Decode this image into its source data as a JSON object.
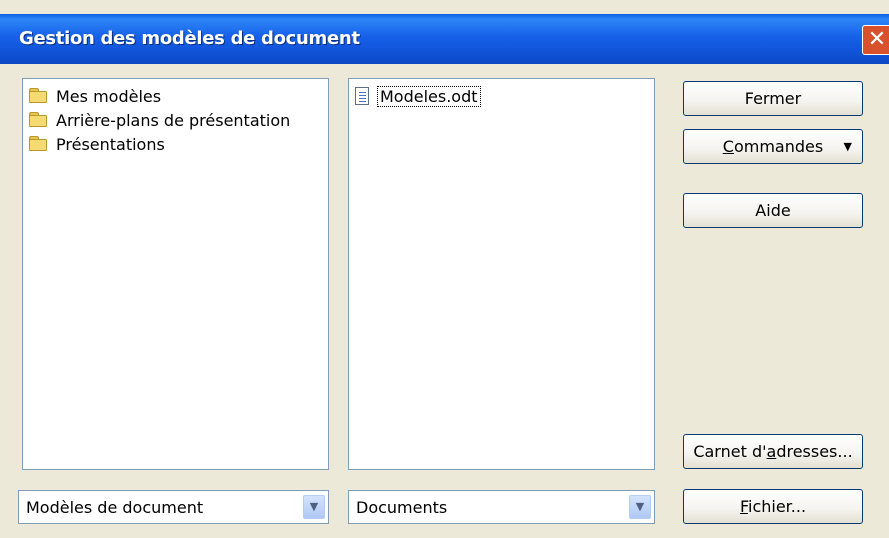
{
  "window": {
    "title": "Gestion des modèles de document",
    "close_glyph": "✕",
    "colors": {
      "titlebar": "#0f52d6",
      "background": "#ece9d8",
      "close": "#d9512c"
    }
  },
  "categories": {
    "items": [
      {
        "label": "Mes modèles",
        "icon": "folder-icon"
      },
      {
        "label": "Arrière-plans de présentation",
        "icon": "folder-icon"
      },
      {
        "label": "Présentations",
        "icon": "folder-icon"
      }
    ],
    "combo_value": "Modèles de document"
  },
  "documents": {
    "items": [
      {
        "label": "Modeles.odt",
        "icon": "document-icon"
      }
    ],
    "combo_value": "Documents"
  },
  "buttons": {
    "close": {
      "label": "Fermer"
    },
    "commands": {
      "mnemonic": "C",
      "rest": "ommandes",
      "arrow": "▼"
    },
    "help": {
      "label": "Aide"
    },
    "address_book": {
      "pre": "Carnet d'",
      "mnemonic": "a",
      "post": "dresses..."
    },
    "file": {
      "mnemonic": "F",
      "rest": "ichier..."
    }
  }
}
